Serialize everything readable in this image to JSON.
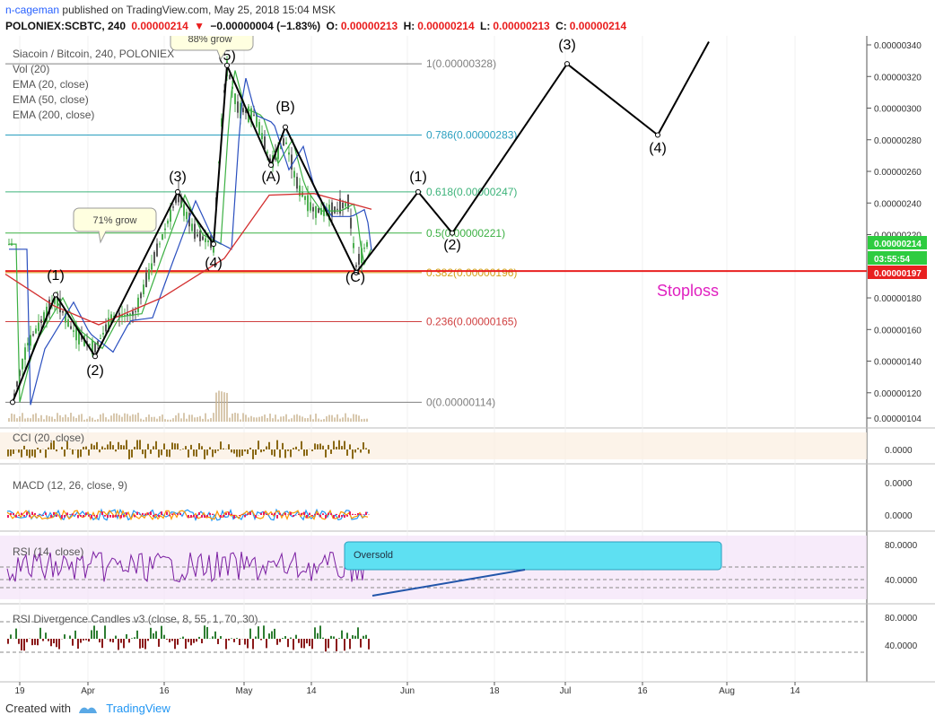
{
  "header": {
    "user": "n-cageman",
    "published": "published on TradingView.com, May 25, 2018 15:04 MSK",
    "symbol": "POLONIEX:SCBTC, 240",
    "last": "0.00000214",
    "change": "−0.00000004 (−1.83%)",
    "o_label": "O:",
    "o_value": "0.00000213",
    "h_label": "H:",
    "h_value": "0.00000214",
    "l_label": "L:",
    "l_value": "0.00000213",
    "c_label": "C:",
    "c_value": "0.00000214"
  },
  "legend": [
    "Siacoin / Bitcoin, 240, POLONIEX",
    "Vol (20)",
    "EMA (20, close)",
    "EMA (50, close)",
    "EMA (200, close)"
  ],
  "footer": {
    "created_with": "Created with",
    "brand": "TradingView"
  },
  "chart_data": {
    "type": "line",
    "price_scale": {
      "labels": [
        "0.00000340",
        "0.00000320",
        "0.00000300",
        "0.00000280",
        "0.00000260",
        "0.00000240",
        "0.00000220",
        "0.00000180",
        "0.00000160",
        "0.00000140",
        "0.00000120",
        "0.00000104"
      ],
      "range": [
        1.04e-06,
        3.42e-06
      ]
    },
    "x_ticks": [
      "19",
      "Apr",
      "16",
      "May",
      "14",
      "Jun",
      "18",
      "Jul",
      "16",
      "Aug",
      "14"
    ],
    "price_badges": [
      {
        "value": "0.00000214",
        "color": "#2ecc40"
      },
      {
        "value": "03:55:54",
        "color": "#2ecc40"
      },
      {
        "value": "0.00000197",
        "color": "#e82020"
      }
    ],
    "fib_levels": [
      {
        "label": "1(0.00000328)",
        "value": 3.28e-06,
        "color": "#808080"
      },
      {
        "label": "0.786(0.00000283)",
        "value": 2.83e-06,
        "color": "#2a9fbf"
      },
      {
        "label": "0.618(0.00000247)",
        "value": 2.47e-06,
        "color": "#3db37a"
      },
      {
        "label": "0.5(0.00000221)",
        "value": 2.21e-06,
        "color": "#3cb043"
      },
      {
        "label": "0.382(0.00000196)",
        "value": 1.96e-06,
        "color": "#d4a017"
      },
      {
        "label": "0.236(0.00000165)",
        "value": 1.65e-06,
        "color": "#d04040"
      },
      {
        "label": "0(0.00000114)",
        "value": 1.14e-06,
        "color": "#808080"
      }
    ],
    "stoploss": {
      "label": "Stoploss",
      "value": 1.97e-06,
      "color": "#e82020",
      "label_color": "#e020c0"
    },
    "wave_labels": [
      "(1)",
      "(2)",
      "(3)",
      "(4)",
      "(5)",
      "(A)",
      "(B)",
      "(C)",
      "(1)",
      "(2)",
      "(3)",
      "(4)"
    ],
    "callouts": [
      {
        "text": "71% grow"
      },
      {
        "text": "88% grow"
      },
      {
        "text": "Oversold"
      }
    ],
    "indicators": [
      {
        "name": "CCI (20, close)",
        "scale_labels": [
          "0.0000"
        ]
      },
      {
        "name": "MACD (12, 26, close, 9)",
        "scale_labels": [
          "0.0000",
          "0.0000"
        ]
      },
      {
        "name": "RSI (14, close)",
        "scale_labels": [
          "80.0000",
          "40.0000"
        ]
      },
      {
        "name": "RSI Divergence Candles v3 (close, 8, 55, 1, 70, 30)",
        "scale_labels": [
          "80.0000",
          "40.0000"
        ]
      }
    ]
  }
}
